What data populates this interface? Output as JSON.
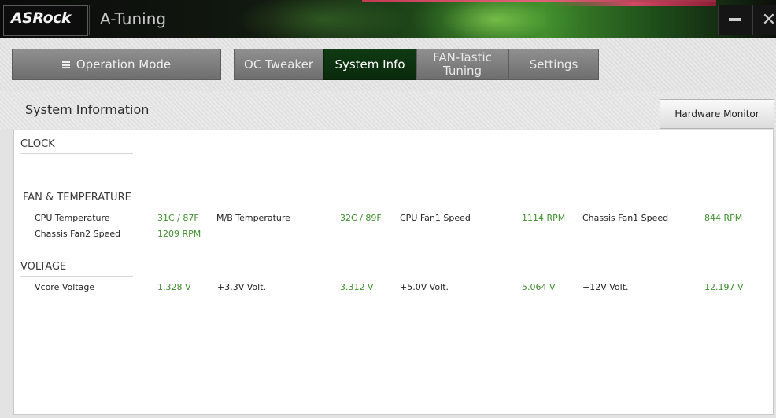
{
  "window": {
    "logo": "ASRock",
    "app_title": "A-Tuning",
    "minimize_label": "",
    "close_label": "✕"
  },
  "nav": {
    "operation_mode": "Operation Mode",
    "tabs": [
      {
        "label": "OC Tweaker",
        "active": false
      },
      {
        "label": "System Info",
        "active": true
      },
      {
        "label": "FAN-Tastic Tuning",
        "active": false
      },
      {
        "label": "Settings",
        "active": false
      }
    ]
  },
  "page": {
    "title": "System Information",
    "hardware_monitor_button": "Hardware Monitor"
  },
  "sections": {
    "clock": {
      "title": "CLOCK"
    },
    "fan_temp": {
      "title": "FAN & TEMPERATURE",
      "rows": [
        [
          {
            "label": "CPU Temperature",
            "value": "31C / 87F"
          },
          {
            "label": "M/B Temperature",
            "value": "32C / 89F"
          },
          {
            "label": "CPU Fan1 Speed",
            "value": "1114 RPM"
          },
          {
            "label": "Chassis Fan1 Speed",
            "value": "844 RPM"
          }
        ],
        [
          {
            "label": "Chassis Fan2 Speed",
            "value": "1209 RPM"
          }
        ]
      ]
    },
    "voltage": {
      "title": "VOLTAGE",
      "rows": [
        [
          {
            "label": "Vcore Voltage",
            "value": "1.328 V"
          },
          {
            "label": "+3.3V Volt.",
            "value": "3.312 V"
          },
          {
            "label": "+5.0V Volt.",
            "value": "5.064 V"
          },
          {
            "label": "+12V Volt.",
            "value": "12.197 V"
          }
        ]
      ]
    }
  },
  "colors": {
    "active_tab": "#0f3a12",
    "value_green": "#3f8f2f"
  }
}
